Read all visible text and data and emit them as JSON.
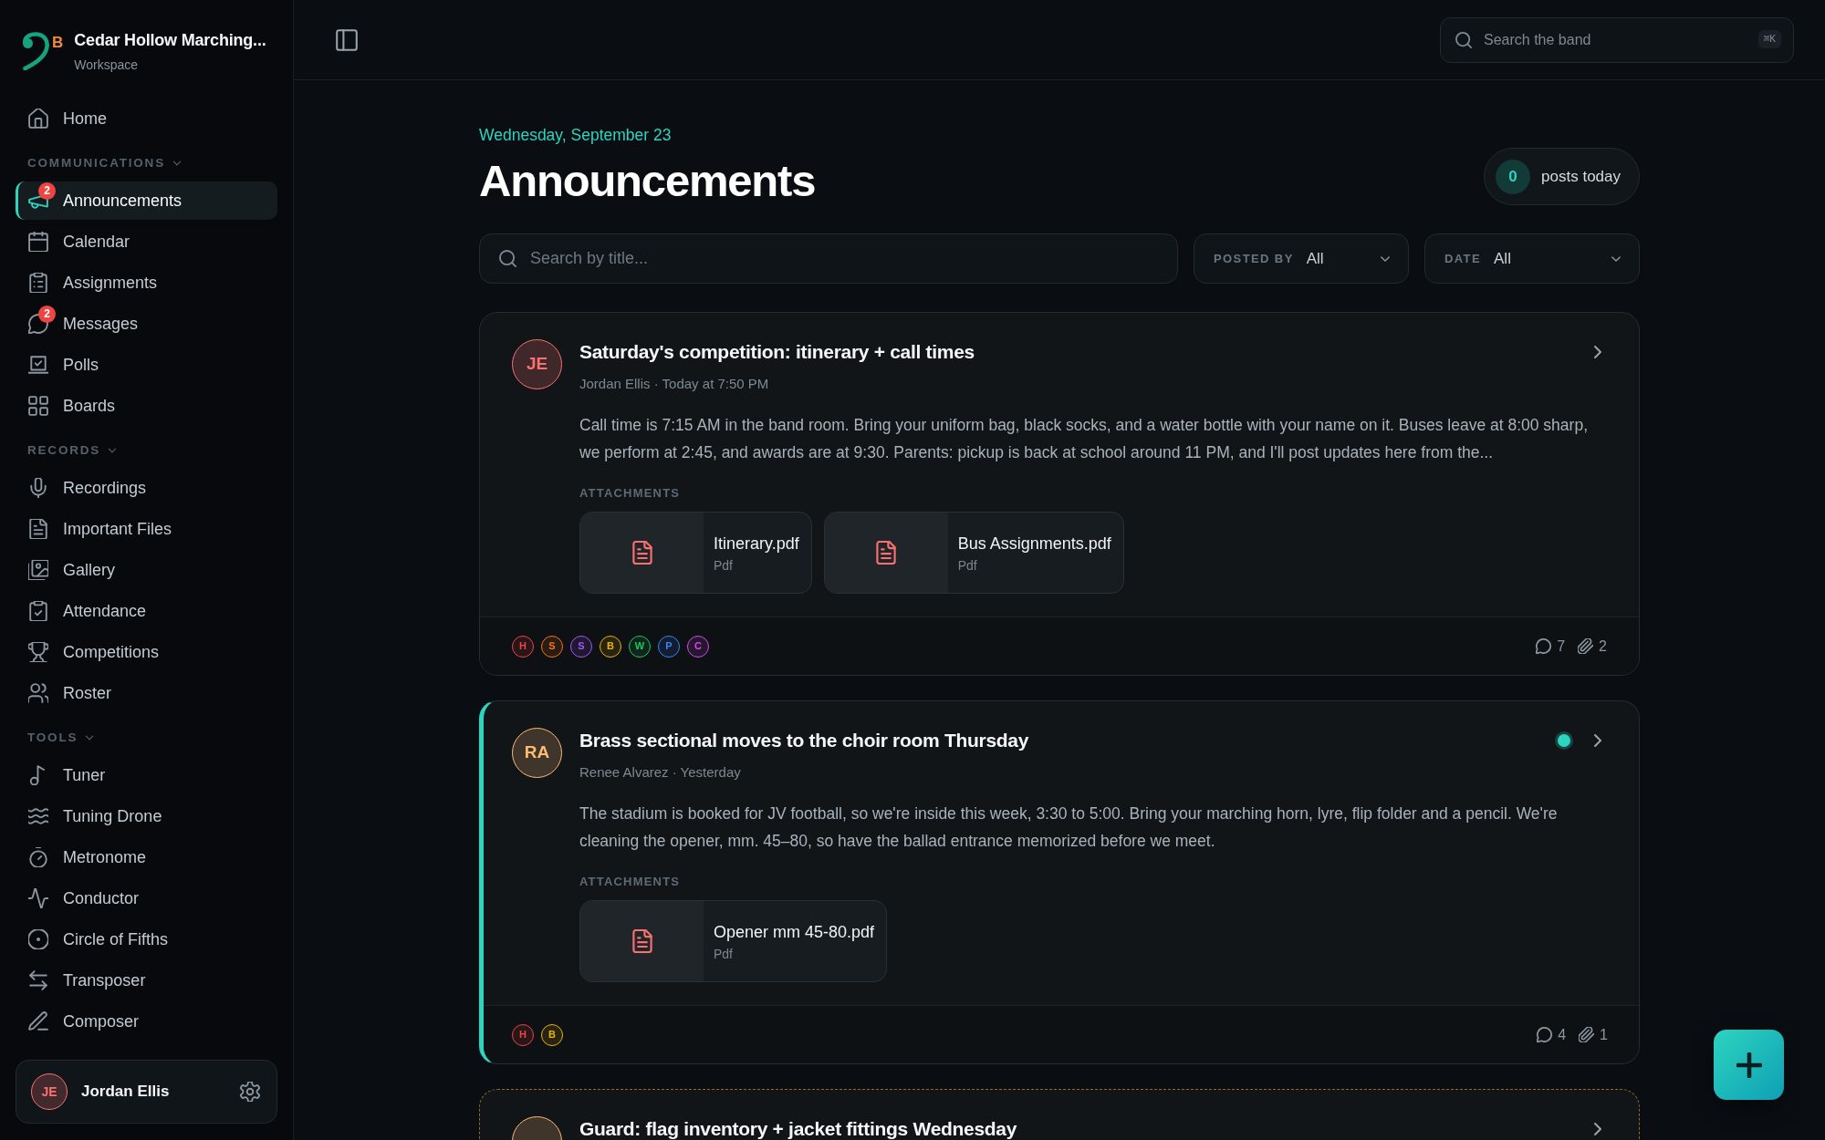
{
  "sidebar": {
    "workspace": {
      "logo_letter": "B",
      "name": "Cedar Hollow Marching...",
      "subtitle": "Workspace"
    },
    "sections": [
      {
        "items": [
          {
            "label": "Home",
            "selected": false
          }
        ]
      },
      {
        "heading": "COMMUNICATIONS",
        "expanded": true,
        "items": [
          {
            "label": "Announcements",
            "selected": true,
            "badge": "2"
          },
          {
            "label": "Calendar",
            "selected": false
          },
          {
            "label": "Assignments",
            "selected": false
          },
          {
            "label": "Messages",
            "selected": false,
            "badge": "2"
          },
          {
            "label": "Polls",
            "selected": false
          },
          {
            "label": "Boards",
            "selected": false
          }
        ]
      },
      {
        "heading": "RECORDS",
        "expanded": true,
        "items": [
          {
            "label": "Recordings",
            "selected": false
          },
          {
            "label": "Important Files",
            "selected": false
          },
          {
            "label": "Gallery",
            "selected": false
          },
          {
            "label": "Attendance",
            "selected": false
          },
          {
            "label": "Competitions",
            "selected": false
          },
          {
            "label": "Roster",
            "selected": false
          }
        ]
      },
      {
        "heading": "TOOLS",
        "expanded": true,
        "items": [
          {
            "label": "Tuner",
            "selected": false
          },
          {
            "label": "Tuning Drone",
            "selected": false
          },
          {
            "label": "Metronome",
            "selected": false
          },
          {
            "label": "Conductor",
            "selected": false
          },
          {
            "label": "Circle of Fifths",
            "selected": false
          },
          {
            "label": "Transposer",
            "selected": false
          },
          {
            "label": "Composer",
            "selected": false
          }
        ]
      }
    ],
    "user": {
      "initials": "JE",
      "name": "Jordan Ellis",
      "color": "#f87171"
    }
  },
  "topbar": {
    "search": {
      "placeholder": "Search the band",
      "shortcut": "⌘K"
    }
  },
  "page": {
    "date": "Wednesday, September 23",
    "title": "Announcements",
    "posts_today": {
      "count": "0",
      "label": "posts today"
    },
    "filters": {
      "search": {
        "placeholder": "Search by title..."
      },
      "selects": [
        {
          "label": "POSTED BY",
          "value": "All"
        },
        {
          "label": "DATE",
          "value": "All"
        }
      ]
    }
  },
  "cards": [
    {
      "dashed": false,
      "unread": false,
      "avatar": {
        "initials": "JE",
        "color": "#f87171"
      },
      "title": "Saturday's competition: itinerary + call times",
      "meta": "Jordan Ellis · Today at 7:50 PM",
      "body": "Call time is 7:15 AM in the band room. Bring your uniform bag, black socks, and a water bottle with your name on it. Buses leave at 8:00 sharp, we perform at 2:45, and awards are at 9:30. Parents: pickup is back at school around 11 PM, and I'll post updates here from the...",
      "attachments_label": "ATTACHMENTS",
      "attachments": [
        {
          "name": "Itinerary.pdf",
          "type": "Pdf"
        },
        {
          "name": "Bus Assignments.pdf",
          "type": "Pdf"
        }
      ],
      "tags": [
        {
          "letter": "H",
          "color": "#ef4444"
        },
        {
          "letter": "S",
          "color": "#f97316"
        },
        {
          "letter": "S",
          "color": "#a855f7"
        },
        {
          "letter": "B",
          "color": "#eab308"
        },
        {
          "letter": "W",
          "color": "#22c55e"
        },
        {
          "letter": "P",
          "color": "#3b82f6"
        },
        {
          "letter": "C",
          "color": "#d946ef"
        }
      ],
      "comments": "7",
      "attachment_count": "2"
    },
    {
      "dashed": false,
      "unread": true,
      "avatar": {
        "initials": "RA",
        "color": "#fdba74"
      },
      "title": "Brass sectional moves to the choir room Thursday",
      "meta": "Renee Alvarez · Yesterday",
      "body": "The stadium is booked for JV football, so we're inside this week, 3:30 to 5:00. Bring your marching horn, lyre, flip folder and a pencil. We're cleaning the opener, mm. 45–80, so have the ballad entrance memorized before we meet.",
      "attachments_label": "ATTACHMENTS",
      "attachments": [
        {
          "name": "Opener mm 45-80.pdf",
          "type": "Pdf"
        }
      ],
      "tags": [
        {
          "letter": "H",
          "color": "#ef4444"
        },
        {
          "letter": "B",
          "color": "#eab308"
        }
      ],
      "comments": "4",
      "attachment_count": "1"
    },
    {
      "dashed": true,
      "unread": false,
      "avatar": {
        "color": "#fdba74"
      },
      "title": "Guard: flag inventory + jacket fittings Wednesday"
    }
  ]
}
